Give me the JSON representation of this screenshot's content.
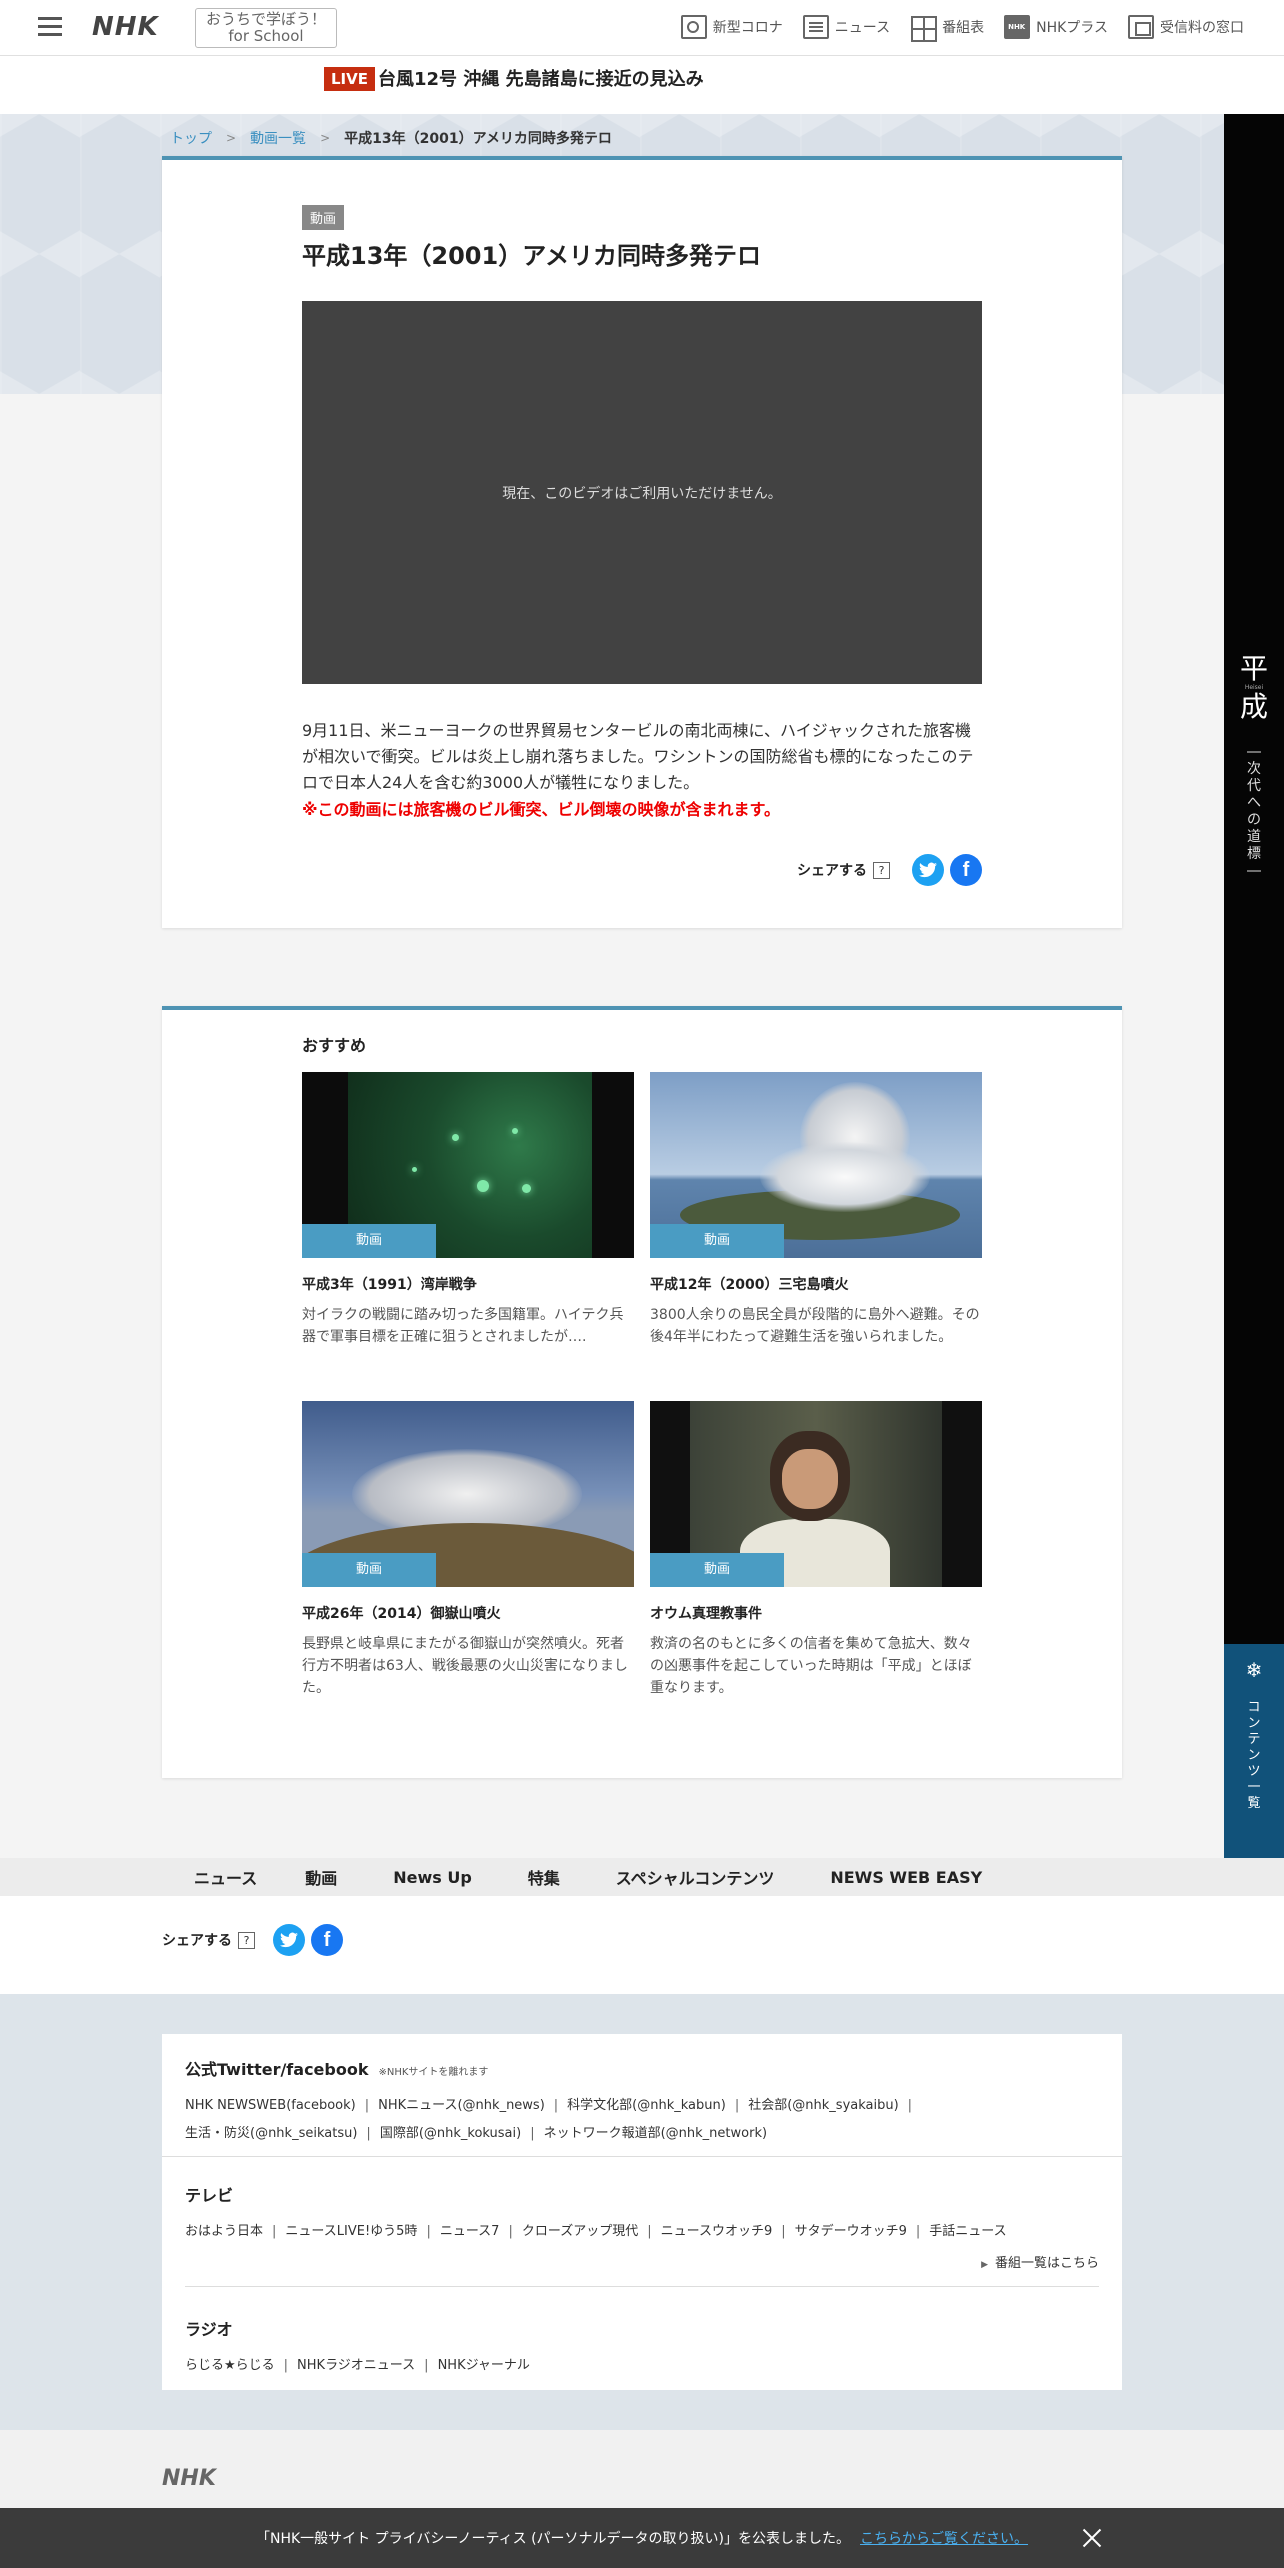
{
  "header": {
    "logo": "NHK",
    "school_line1": "おうちで学ぼう！",
    "school_line2": "for School",
    "nav": [
      {
        "label": "新型コロナ",
        "icon": "corona-icon"
      },
      {
        "label": "ニュース",
        "icon": "news-icon"
      },
      {
        "label": "番組表",
        "icon": "program-grid-icon"
      },
      {
        "label": "NHKプラス",
        "icon": "nhk-plus-icon"
      },
      {
        "label": "受信料の窓口",
        "icon": "fee-window-icon"
      }
    ]
  },
  "live": {
    "badge": "LIVE",
    "text": "台風12号 沖縄 先島諸島に接近の見込み"
  },
  "breadcrumb": {
    "items": [
      "トップ",
      "動画一覧"
    ],
    "current": "平成13年（2001）アメリカ同時多発テロ"
  },
  "article": {
    "tag": "動画",
    "title": "平成13年（2001）アメリカ同時多発テロ",
    "video_message": "現在、このビデオはご利用いただけません。",
    "description": "9月11日、米ニューヨークの世界貿易センタービルの南北両棟に、ハイジャックされた旅客機が相次いで衝突。ビルは炎上し崩れ落ちました。ワシントンの国防総省も標的になったこのテロで日本人24人を含む約3000人が犠牲になりました。",
    "warning": "※この動画には旅客機のビル衝突、ビル倒壊の映像が含まれます。",
    "share_label": "シェアする",
    "help": "?"
  },
  "recommend": {
    "title": "おすすめ",
    "items": [
      {
        "badge": "動画",
        "title": "平成3年（1991）湾岸戦争",
        "desc": "対イラクの戦闘に踏み切った多国籍軍。ハイテク兵器で軍事目標を正確に狙うとされましたが…."
      },
      {
        "badge": "動画",
        "title": "平成12年（2000）三宅島噴火",
        "desc": "3800人余りの島民全員が段階的に島外へ避難。その後4年半にわたって避難生活を強いられました。"
      },
      {
        "badge": "動画",
        "title": "平成26年（2014）御嶽山噴火",
        "desc": "長野県と岐阜県にまたがる御嶽山が突然噴火。死者行方不明者は63人、戦後最悪の火山災害になりました。"
      },
      {
        "badge": "動画",
        "title": "オウム真理教事件",
        "desc": "救済の名のもとに多くの信者を集めて急拡大、数々の凶悪事件を起こしていった時期は「平成」とほぼ重なります。"
      }
    ]
  },
  "side": {
    "kanji1": "平",
    "roman": "Heisei",
    "kanji2": "成",
    "subtitle": "―次代への道標―",
    "content_label": "コンテンツ一覧"
  },
  "footer_nav": [
    "ニュース",
    "動画",
    "News Up",
    "特集",
    "スペシャルコンテンツ",
    "NEWS WEB EASY"
  ],
  "footer_share": {
    "label": "シェアする",
    "help": "?"
  },
  "footer": {
    "sns_title": "公式Twitter/facebook",
    "sns_note": "※NHKサイトを離れます",
    "sns_links_row1": [
      "NHK NEWSWEB(facebook)",
      "NHKニュース(@nhk_news)",
      "科学文化部(@nhk_kabun)",
      "社会部(@nhk_syakaibu)"
    ],
    "sns_links_row2": [
      "生活・防災(@nhk_seikatsu)",
      "国際部(@nhk_kokusai)",
      "ネットワーク報道部(@nhk_network)"
    ],
    "tv_title": "テレビ",
    "tv_links": [
      "おはよう日本",
      "ニュースLIVE!ゆう5時",
      "ニュース7",
      "クローズアップ現代",
      "ニュースウオッチ9",
      "サタデーウオッチ9",
      "手話ニュース"
    ],
    "tv_more": "番組一覧はこちら",
    "radio_title": "ラジオ",
    "radio_links": [
      "らじる★らじる",
      "NHKラジオニュース",
      "NHKジャーナル"
    ]
  },
  "bottom_logo": "NHK",
  "notice": {
    "text": "「NHK一般サイト プライバシーノーティス (パーソナルデータの取り扱い)」を公表しました。",
    "link": "こちらからご覧ください。"
  }
}
